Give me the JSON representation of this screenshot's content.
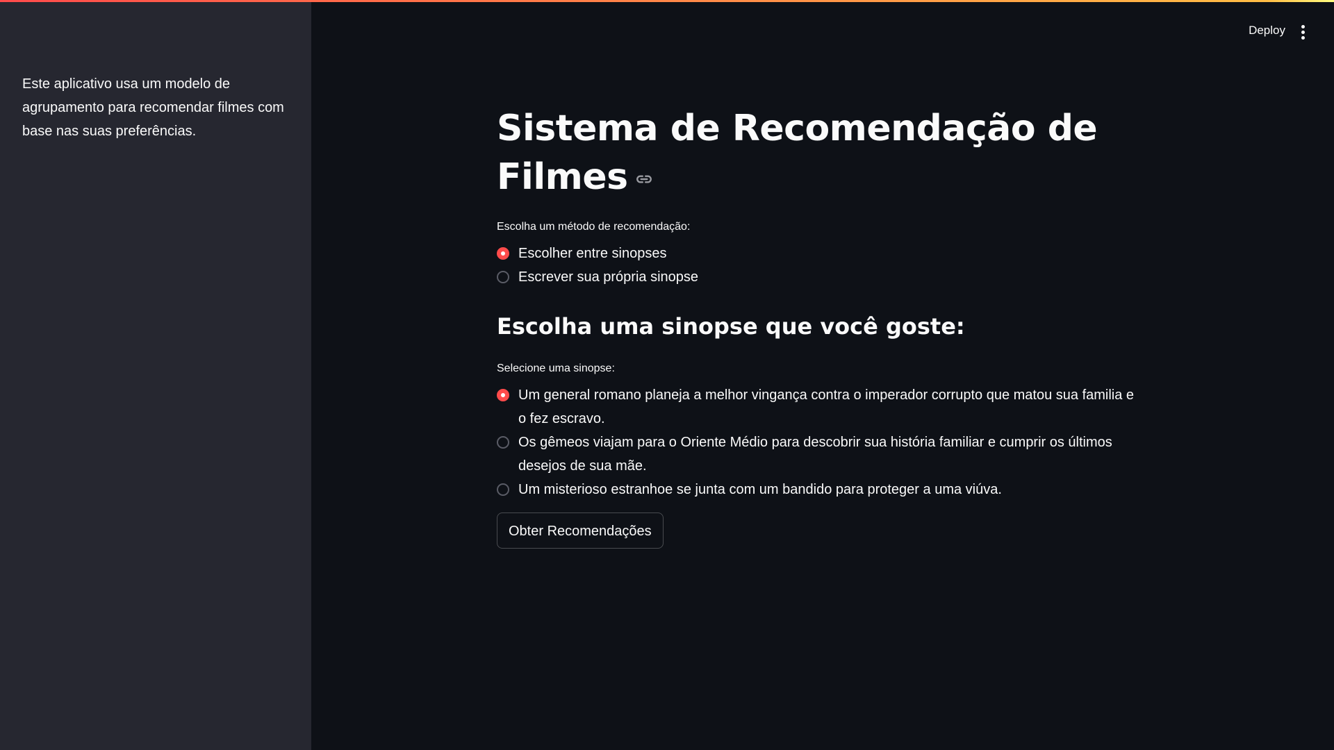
{
  "header": {
    "deploy_label": "Deploy",
    "menu_icon": "vertical-ellipsis-icon"
  },
  "sidebar": {
    "description": "Este aplicativo usa um modelo de agrupamento para recomendar filmes com base nas suas preferências."
  },
  "main": {
    "title": "Sistema de Recomendação de Filmes",
    "anchor_icon": "link-icon",
    "method": {
      "label": "Escolha um método de recomendação:",
      "options": [
        "Escolher entre sinopses",
        "Escrever sua própria sinopse"
      ],
      "selected_index": 0
    },
    "section_title": "Escolha uma sinopse que você goste:",
    "synopsis": {
      "label": "Selecione uma sinopse:",
      "options": [
        "Um general romano planeja a melhor vingança contra o imperador corrupto que matou sua familia e o fez escravo.",
        "Os gêmeos viajam para o Oriente Médio para descobrir sua história familiar e cumprir os últimos desejos de sua mãe.",
        "Um misterioso estranhoe se junta com um bandido para proteger a uma viúva."
      ],
      "selected_index": 0
    },
    "button_label": "Obter Recomendações"
  },
  "colors": {
    "accent": "#ff4b4b",
    "background": "#0e1117",
    "sidebar": "#262730"
  }
}
